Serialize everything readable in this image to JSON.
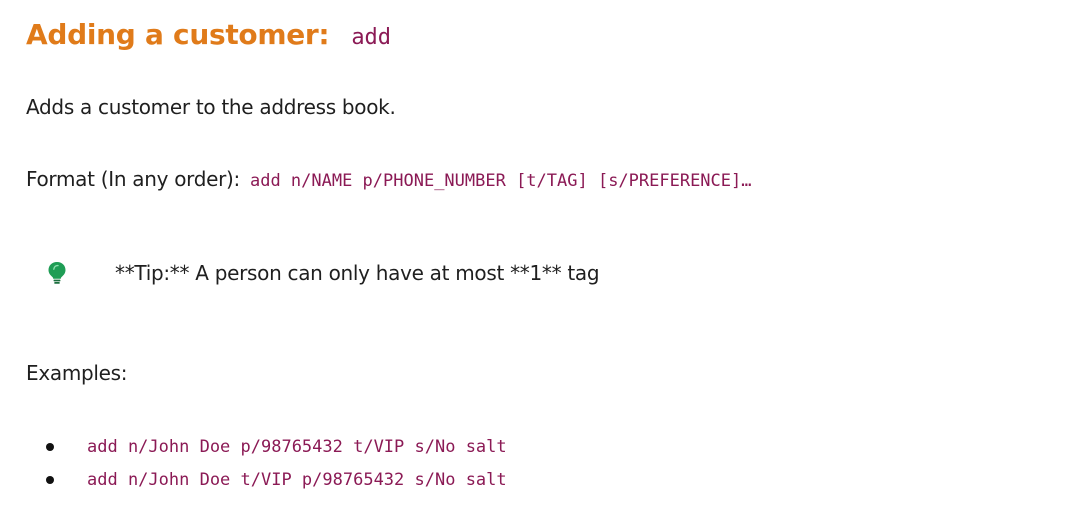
{
  "heading": {
    "title": "Adding a customer:",
    "command": "add"
  },
  "description": "Adds a customer to the address book.",
  "format": {
    "label": "Format (In any order):",
    "syntax": "add n/NAME p/PHONE_NUMBER [t/TAG] [s/PREFERENCE]…"
  },
  "tip": {
    "icon": "lightbulb-icon",
    "icon_color": "#1f9d55",
    "text": "**Tip:** A person can only have at most **1** tag"
  },
  "examples": {
    "label": "Examples:",
    "items": [
      "add n/John Doe p/98765432 t/VIP s/No salt",
      "add n/John Doe t/VIP p/98765432 s/No salt"
    ]
  },
  "colors": {
    "heading": "#e07b1a",
    "code": "#8b1a55",
    "text": "#1f1f1f"
  }
}
